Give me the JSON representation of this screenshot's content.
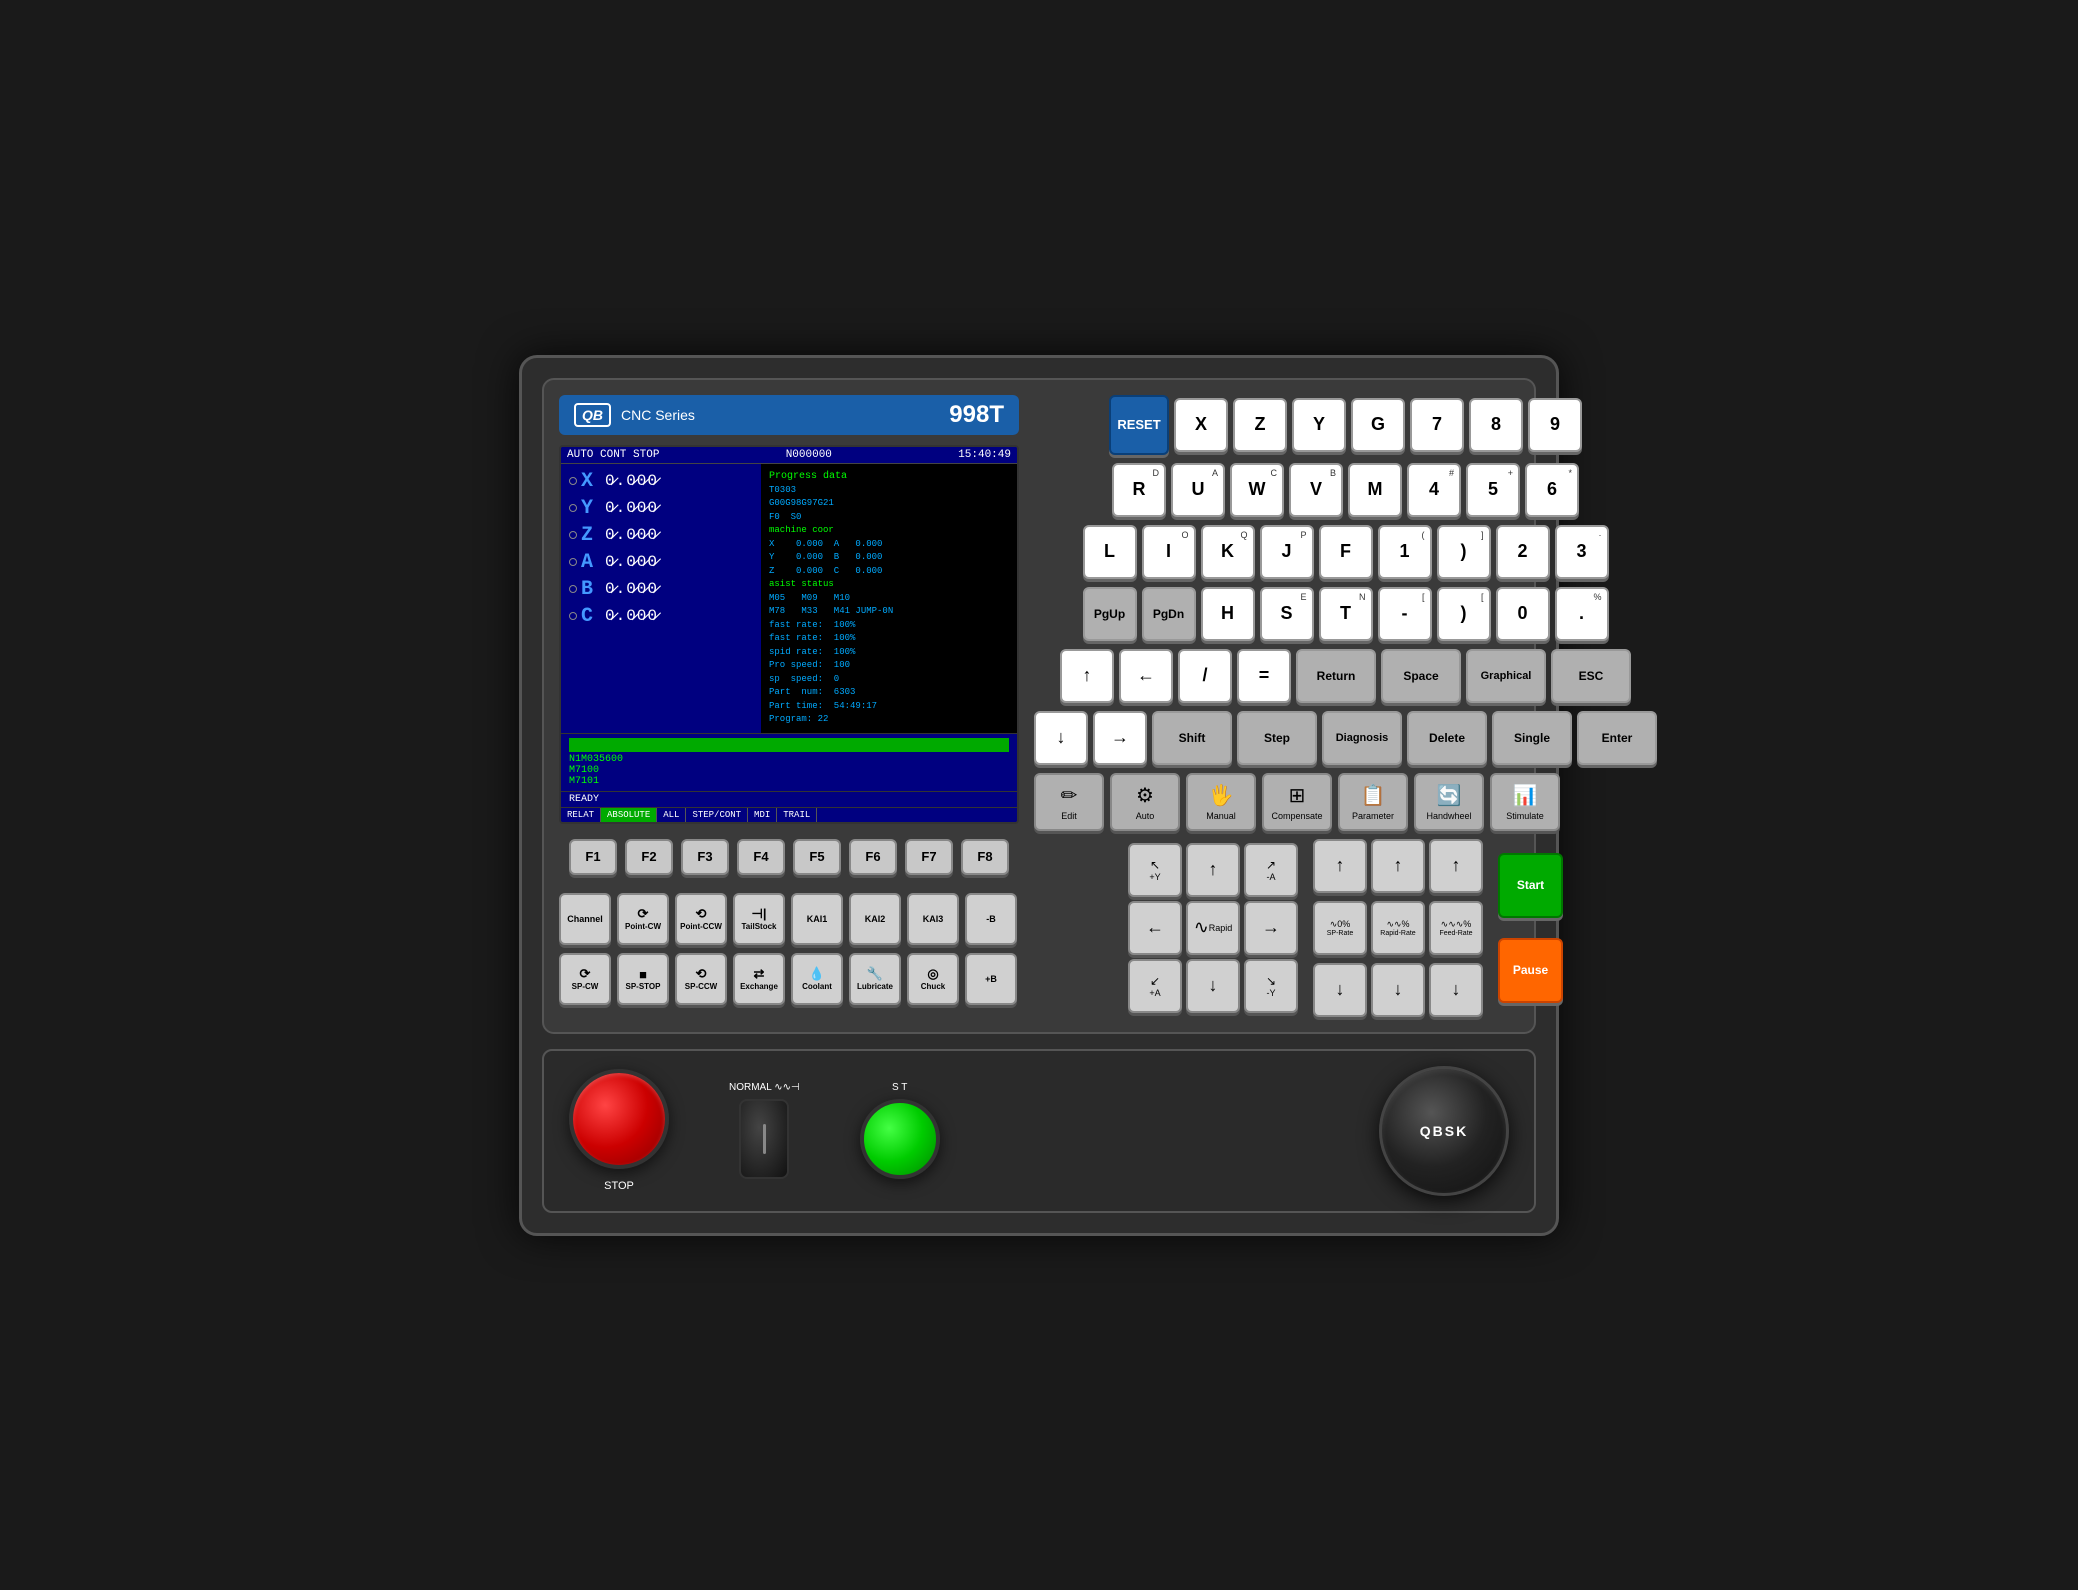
{
  "header": {
    "logo": "QB",
    "series": "CNC  Series",
    "model": "998T"
  },
  "screen": {
    "status": "AUTO  CONT  STOP",
    "program": "N000000",
    "time": "15:40:49",
    "axes": [
      {
        "label": "X",
        "value": "0.000"
      },
      {
        "label": "Y",
        "value": "0.000"
      },
      {
        "label": "Z",
        "value": "0.000"
      },
      {
        "label": "A",
        "value": "0.000"
      },
      {
        "label": "B",
        "value": "0.000"
      },
      {
        "label": "C",
        "value": "0.000"
      }
    ],
    "prog_data": {
      "title": "Progress data",
      "lines": [
        "T0303",
        "G00G98G97G21",
        "F0  S0",
        "machine coor",
        "X    0.000   A    0.000",
        "Y    0.000   B    0.000",
        "Z    0.000   C    0.000",
        "asist status",
        "M05   M09   M10",
        "M78   M33   M41 JUMP-0N",
        "fast rate:  100%",
        "fast rate:  100%",
        "spid rate:  100%",
        "Pro speed:  100",
        "sp  speed:  0",
        "Part  num:  6303",
        "Part time:  54:49:17",
        "Program: 22"
      ]
    },
    "gcode": "N1M035600\nM7100\nM7101",
    "ready": "READY",
    "tabs": [
      "RELAT",
      "ABSOLUTE",
      "ALL",
      "STEP/CONT",
      "MDI",
      "TRAIL"
    ]
  },
  "fkeys": [
    "F1",
    "F2",
    "F3",
    "F4",
    "F5",
    "F6",
    "F7",
    "F8"
  ],
  "ctrl_row1": [
    {
      "label": "Channel",
      "icon": ""
    },
    {
      "label": "Point-CW",
      "icon": "⟳"
    },
    {
      "label": "Point-CCW",
      "icon": "⟲"
    },
    {
      "label": "TailStock",
      "icon": "⊣"
    },
    {
      "label": "KAI1",
      "icon": ""
    },
    {
      "label": "KAI2",
      "icon": ""
    },
    {
      "label": "KAI3",
      "icon": ""
    },
    {
      "label": "-B",
      "icon": ""
    }
  ],
  "ctrl_row2": [
    {
      "label": "SP-CW",
      "icon": "⟳"
    },
    {
      "label": "SP-STOP",
      "icon": "⏹"
    },
    {
      "label": "SP-CCW",
      "icon": "⟲"
    },
    {
      "label": "Exchange",
      "icon": "⇄"
    },
    {
      "label": "Coolant",
      "icon": "💧"
    },
    {
      "label": "Lubricate",
      "icon": "🔧"
    },
    {
      "label": "Chuck",
      "icon": "◎"
    },
    {
      "label": "+B",
      "icon": ""
    }
  ],
  "keyboard": {
    "row1": [
      {
        "label": "RESET",
        "type": "reset"
      },
      {
        "label": "X",
        "super": ""
      },
      {
        "label": "Z",
        "super": ""
      },
      {
        "label": "Y",
        "super": ""
      },
      {
        "label": "G",
        "super": ""
      },
      {
        "label": "7",
        "super": ""
      },
      {
        "label": "8",
        "super": ""
      },
      {
        "label": "9",
        "super": ""
      }
    ],
    "row2": [
      {
        "label": "R",
        "super": "D"
      },
      {
        "label": "U",
        "super": "A"
      },
      {
        "label": "W",
        "super": "C"
      },
      {
        "label": "V",
        "super": "B"
      },
      {
        "label": "M",
        "super": ""
      },
      {
        "label": "4",
        "super": "#"
      },
      {
        "label": "5",
        "super": "+"
      },
      {
        "label": "6",
        "super": "*"
      }
    ],
    "row3": [
      {
        "label": "L",
        "super": ""
      },
      {
        "label": "I",
        "super": "O"
      },
      {
        "label": "K",
        "super": "Q"
      },
      {
        "label": "J",
        "super": "P"
      },
      {
        "label": "F",
        "super": ""
      },
      {
        "label": "1",
        "super": "("
      },
      {
        "label": ")",
        "super": ""
      },
      {
        "label": "2",
        "super": ""
      },
      {
        "label": "3",
        "super": "·"
      }
    ],
    "row4_left": [
      {
        "label": "PgUp",
        "icon": "⬆"
      },
      {
        "label": "PgDn",
        "icon": "⬇"
      }
    ],
    "row4_right": [
      {
        "label": "H",
        "super": ""
      },
      {
        "label": "S",
        "super": "E"
      },
      {
        "label": "T",
        "super": "N"
      },
      {
        "label": "-",
        "super": "["
      },
      {
        "label": ")",
        "super": "["
      },
      {
        "label": "0",
        "super": ""
      },
      {
        "label": ".",
        "super": "%"
      }
    ],
    "row5": [
      {
        "label": "↑",
        "type": "arrow"
      },
      {
        "label": "←",
        "type": "arrow"
      },
      {
        "label": "/",
        "type": ""
      },
      {
        "label": "=",
        "type": ""
      },
      {
        "label": "Return",
        "type": "gray-wide"
      },
      {
        "label": "Space",
        "type": "gray-wide"
      },
      {
        "label": "Graphical",
        "type": "gray-wide"
      },
      {
        "label": "ESC",
        "type": "gray-wide"
      }
    ],
    "row6": [
      {
        "label": "↓",
        "type": "arrow"
      },
      {
        "label": "→",
        "type": "arrow"
      },
      {
        "label": "Shift",
        "type": "gray-wide"
      },
      {
        "label": "Step",
        "type": "gray-wide"
      },
      {
        "label": "Diagnosis",
        "type": "gray-wide"
      },
      {
        "label": "Delete",
        "type": "gray-wide"
      },
      {
        "label": "Single",
        "type": "gray-wide"
      },
      {
        "label": "Enter",
        "type": "gray-wide"
      }
    ],
    "func_row": [
      {
        "label": "Edit",
        "icon": "✏"
      },
      {
        "label": "Auto",
        "icon": "⚙"
      },
      {
        "label": "Manual",
        "icon": "🖐"
      },
      {
        "label": "Compensate",
        "icon": "⊞"
      },
      {
        "label": "Parameter",
        "icon": "📋"
      },
      {
        "label": "Handwheel",
        "icon": "🔄"
      },
      {
        "label": "Stimulate",
        "icon": "📊"
      }
    ]
  },
  "jog": {
    "up_left": "↖+Y",
    "up": "↑",
    "up_right": "↗-A",
    "left": "←",
    "rapid": "Rapid",
    "right": "→",
    "down_left": "↙+A",
    "down": "↓",
    "down_right": "↘-Y",
    "rate_labels": [
      "SP-Rate\n∿0%",
      "Rapid-Rate\n∿∿%",
      "Feed-Rate\n∿∿∿%"
    ]
  },
  "side_btns": {
    "start_label": "Start",
    "pause_label": "Pause"
  },
  "bottom": {
    "stop_label": "STOP",
    "normal_label": "NORMAL ∿∿⊣",
    "st_label": "S T",
    "knob_label": "QBSK"
  }
}
